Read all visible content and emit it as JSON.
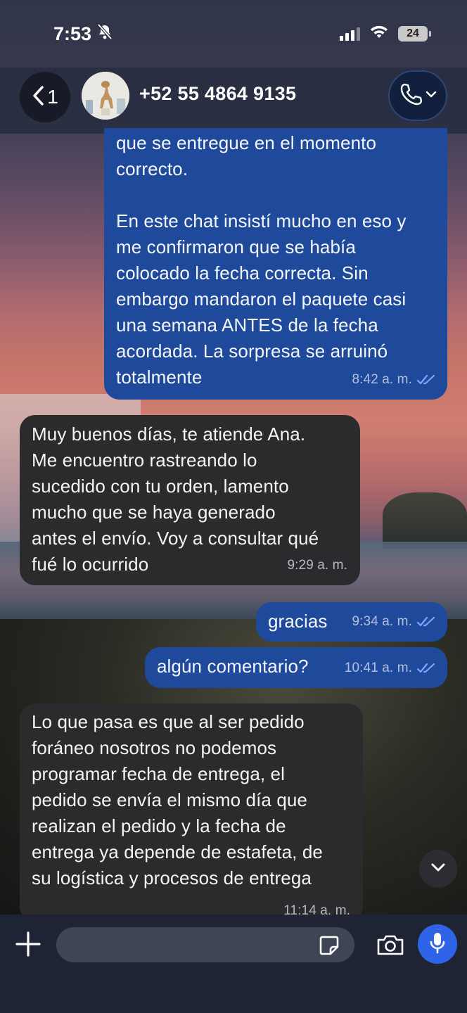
{
  "status_bar": {
    "time": "7:53",
    "battery": "24",
    "icons": [
      "bell-slash-icon",
      "signal-icon",
      "wifi-icon",
      "battery-icon"
    ]
  },
  "header": {
    "back_count": "1",
    "contact_name": "+52 55 4864 9135",
    "icons": [
      "chevron-left-icon",
      "phone-icon",
      "chevron-down-icon"
    ]
  },
  "messages": [
    {
      "direction": "outgoing",
      "lines": [
        "que se entregue en el momento",
        "correcto.",
        "",
        "En este chat insistí mucho en eso y",
        "me confirmaron que se había",
        "colocado la fecha correcta. Sin",
        "embargo mandaron el paquete casi",
        "una semana ANTES de la fecha",
        "acordada. La sorpresa se arruinó",
        "totalmente"
      ],
      "time": "8:42 a. m.",
      "read": true
    },
    {
      "direction": "incoming",
      "lines": [
        "Muy buenos días, te atiende Ana.",
        "Me encuentro rastreando lo",
        "sucedido con tu orden, lamento",
        "mucho que se haya generado",
        "antes el envío. Voy a consultar qué",
        "fué lo ocurrido"
      ],
      "time": "9:29 a. m."
    },
    {
      "direction": "outgoing",
      "lines": [
        "gracias"
      ],
      "time": "9:34 a. m.",
      "read": true
    },
    {
      "direction": "outgoing",
      "lines": [
        "algún comentario?"
      ],
      "time": "10:41 a. m.",
      "read": true
    },
    {
      "direction": "incoming",
      "lines": [
        "Lo que pasa es que al ser pedido",
        "foráneo nosotros no podemos",
        "programar fecha de entrega, el",
        "pedido se envía el mismo día que",
        "realizan el pedido y la fecha de",
        "entrega ya depende de estafeta, de",
        "su logística y procesos de entrega"
      ],
      "time": "11:14 a. m."
    }
  ],
  "input_bar": {
    "placeholder": "",
    "icons": [
      "plus-icon",
      "sticker-icon",
      "camera-icon",
      "microphone-icon"
    ]
  },
  "colors": {
    "outgoing_bubble": "#1f4a9c",
    "incoming_bubble": "#2b2b2d",
    "mic_button": "#2f64e8",
    "read_ticks": "#7fa6ff"
  }
}
